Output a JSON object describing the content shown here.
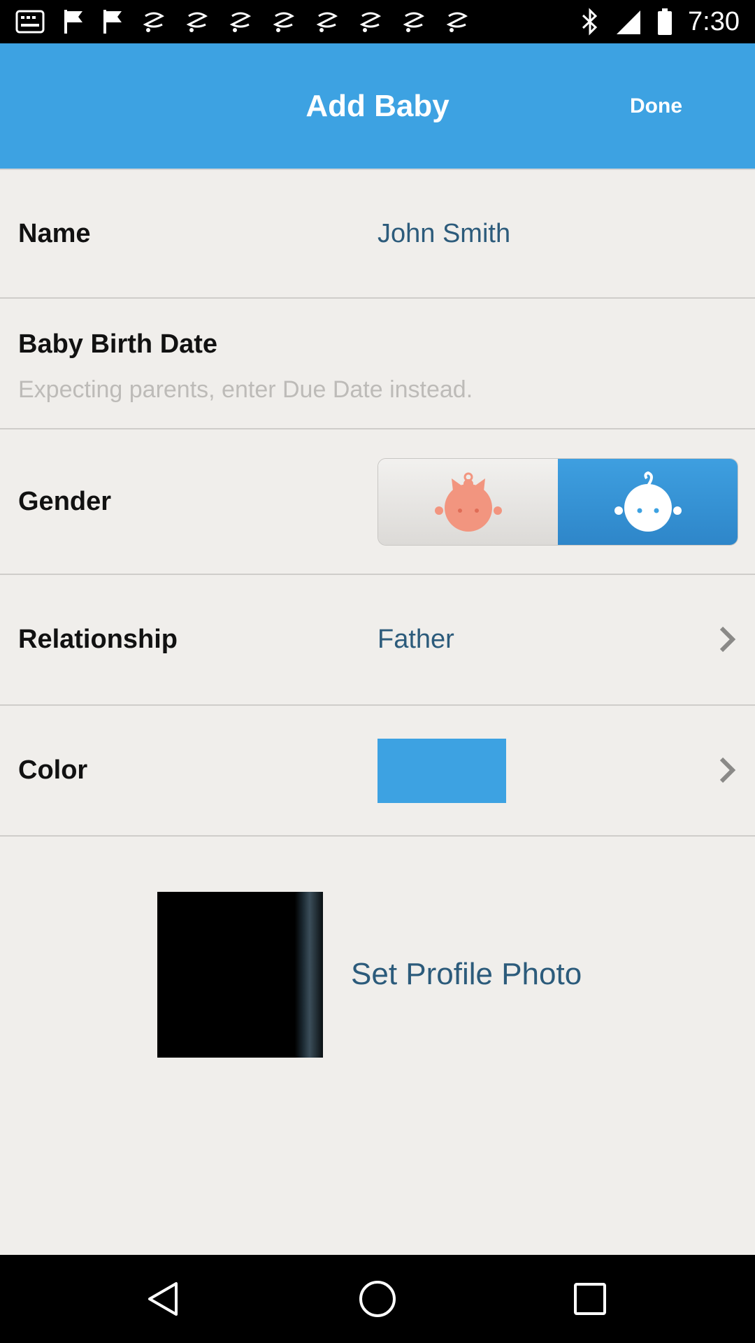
{
  "status_bar": {
    "time": "7:30",
    "left_icons": [
      "message-icon",
      "flag-icon",
      "flag-icon",
      "spiral-icon",
      "spiral-icon",
      "spiral-icon",
      "spiral-icon",
      "spiral-icon",
      "spiral-icon",
      "spiral-icon",
      "spiral-icon"
    ],
    "right_icons": [
      "bluetooth-icon",
      "signal-icon",
      "battery-icon"
    ]
  },
  "header": {
    "title": "Add Baby",
    "done_label": "Done",
    "background_color": "#3da2e2"
  },
  "form": {
    "name": {
      "label": "Name",
      "value": "John Smith"
    },
    "birth_date": {
      "label": "Baby Birth Date",
      "hint": "Expecting parents, enter Due Date instead."
    },
    "gender": {
      "label": "Gender",
      "options": [
        "girl",
        "boy"
      ],
      "selected": "boy"
    },
    "relationship": {
      "label": "Relationship",
      "value": "Father"
    },
    "color": {
      "label": "Color",
      "value": "#3da2e2"
    }
  },
  "profile": {
    "set_photo_label": "Set Profile Photo"
  },
  "nav_bar": {
    "buttons": [
      "back-icon",
      "home-icon",
      "recents-icon"
    ]
  },
  "colors": {
    "accent": "#3da2e2",
    "value_text": "#2c5b7b",
    "background": "#f0eeeb"
  }
}
